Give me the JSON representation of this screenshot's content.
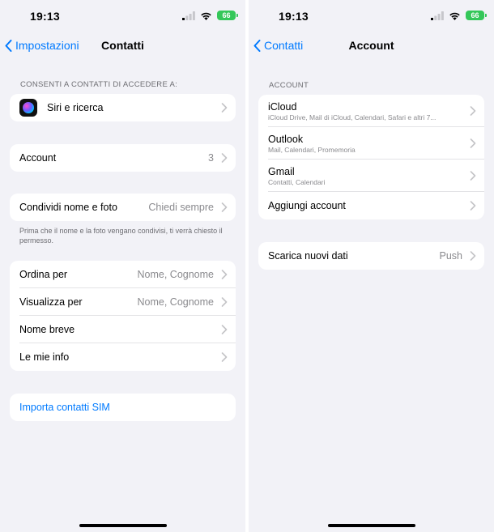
{
  "left": {
    "status": {
      "time": "19:13",
      "battery": "66"
    },
    "nav": {
      "back_label": "Impostazioni",
      "title": "Contatti"
    },
    "access_header": "CONSENTI A CONTATTI DI ACCEDERE A:",
    "siri_label": "Siri e ricerca",
    "account": {
      "label": "Account",
      "value": "3"
    },
    "share": {
      "label": "Condividi nome e foto",
      "value": "Chiedi sempre"
    },
    "share_footnote": "Prima che il nome e la foto vengano condivisi, ti verrà chiesto il permesso.",
    "settings": [
      {
        "label": "Ordina per",
        "value": "Nome, Cognome"
      },
      {
        "label": "Visualizza per",
        "value": "Nome, Cognome"
      },
      {
        "label": "Nome breve",
        "value": ""
      },
      {
        "label": "Le mie info",
        "value": ""
      }
    ],
    "import_sim_label": "Importa contatti SIM"
  },
  "right": {
    "status": {
      "time": "19:13",
      "battery": "66"
    },
    "nav": {
      "back_label": "Contatti",
      "title": "Account"
    },
    "accounts_header": "ACCOUNT",
    "accounts": [
      {
        "name": "iCloud",
        "detail": "iCloud Drive, Mail di iCloud, Calendari, Safari e altri 7..."
      },
      {
        "name": "Outlook",
        "detail": "Mail, Calendari, Promemoria"
      },
      {
        "name": "Gmail",
        "detail": "Contatti, Calendari"
      }
    ],
    "add_account_label": "Aggiungi account",
    "fetch": {
      "label": "Scarica nuovi dati",
      "value": "Push"
    }
  },
  "colors": {
    "accent": "#007aff",
    "background": "#f2f2f7",
    "battery": "#34c759"
  },
  "icons": [
    "chevron-left-icon",
    "chevron-right-icon",
    "signal-icon",
    "wifi-icon",
    "battery-icon",
    "siri-icon"
  ]
}
